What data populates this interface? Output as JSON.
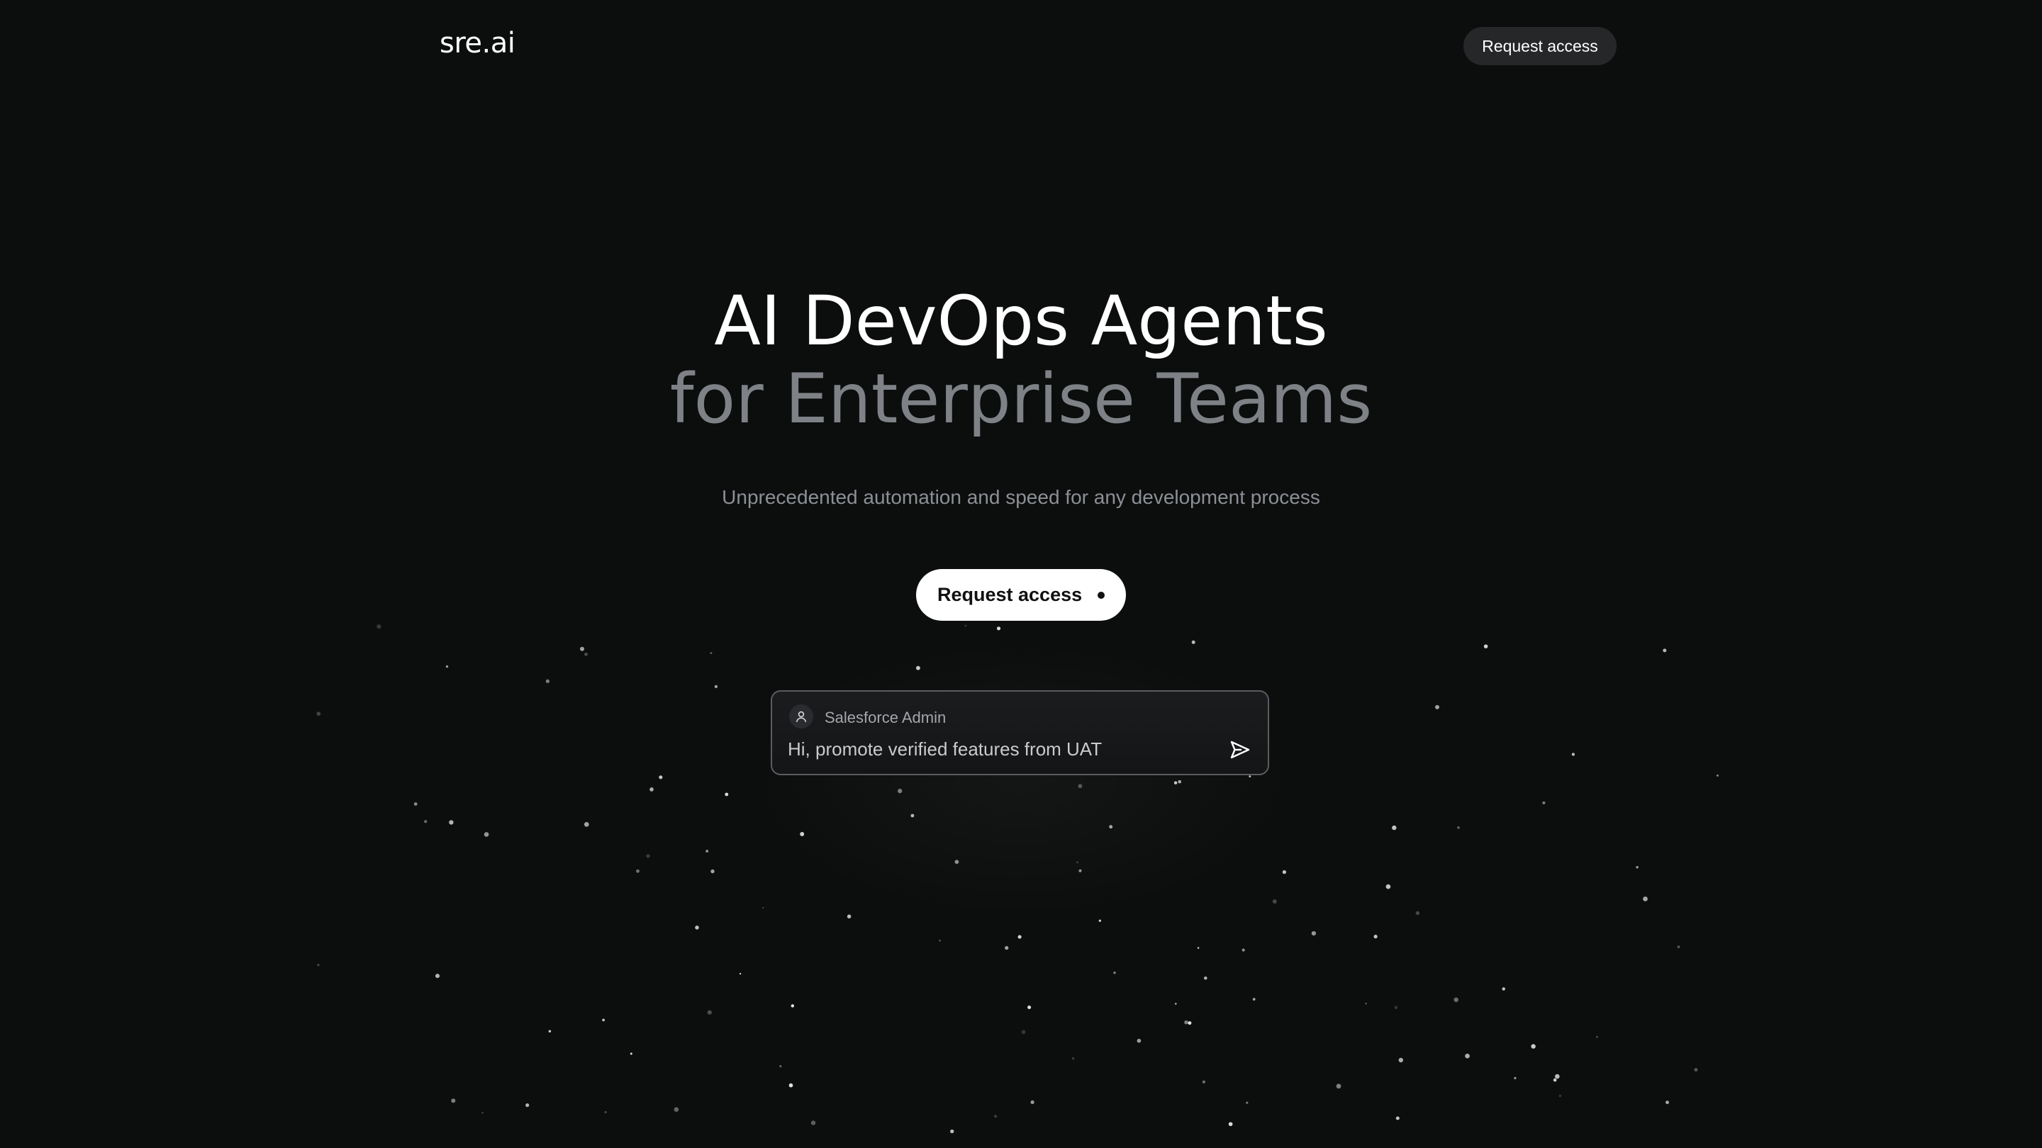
{
  "header": {
    "logo": "sre.ai",
    "nav_button_label": "Request access"
  },
  "hero": {
    "title_line1": "AI DevOps Agents",
    "title_line2": "for Enterprise Teams",
    "subtitle": "Unprecedented automation and speed for any development process",
    "cta_label": "Request access"
  },
  "chat": {
    "role_label": "Salesforce Admin",
    "message": "Hi, promote verified features from UAT",
    "avatar_icon": "user-icon",
    "send_icon": "send-icon"
  },
  "colors": {
    "background": "#0c0d0d",
    "title_primary": "#ffffff",
    "title_secondary": "#7e8287",
    "subtitle": "#8c9095",
    "chip": "#262728"
  }
}
